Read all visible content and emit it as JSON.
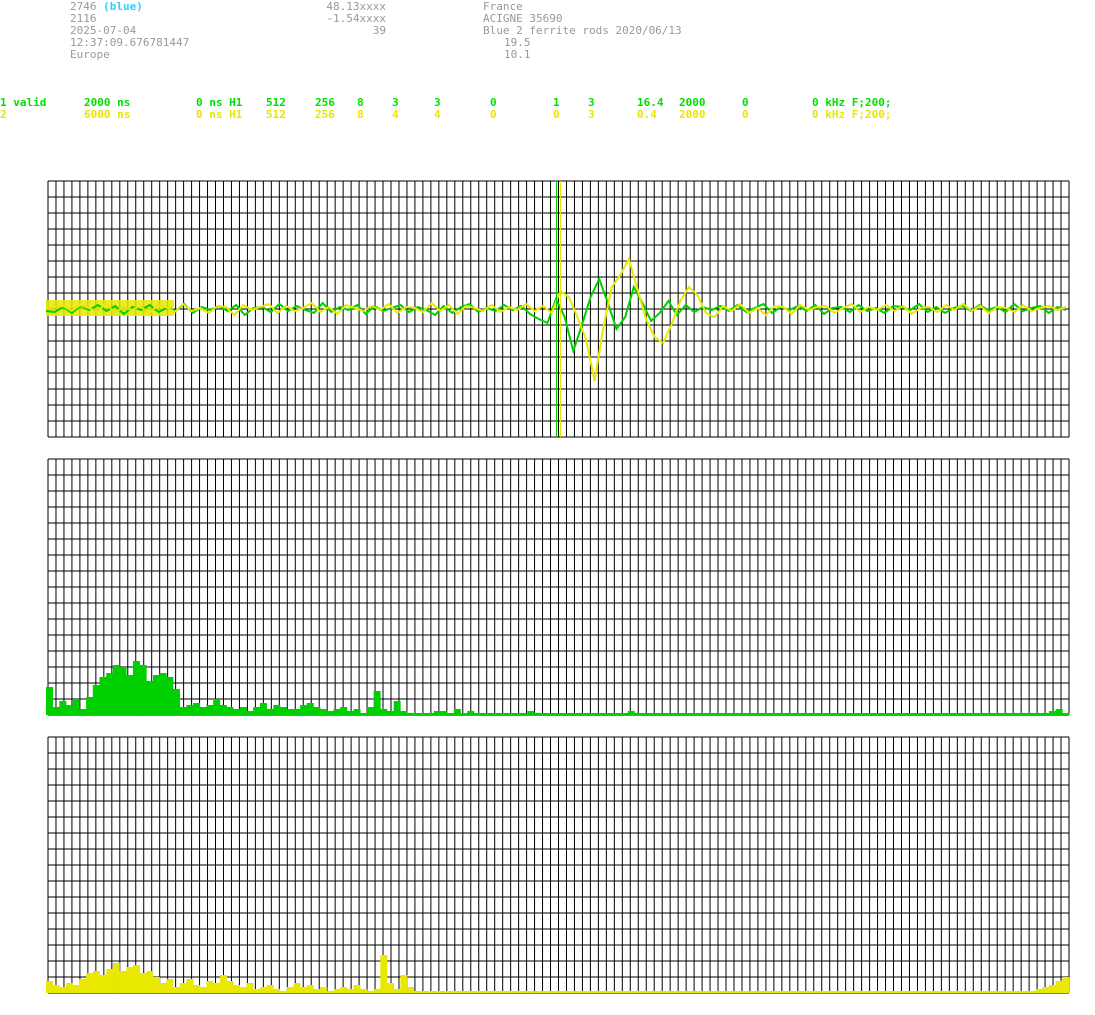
{
  "station": {
    "id": "2746",
    "color_label": "(blue)",
    "number": "2116",
    "date": "2025-07-04",
    "time": "12:37:09.676781447",
    "region": "Europe"
  },
  "coordinates": {
    "lat": "48.13xxxx",
    "lon": "-1.54xxxx",
    "value": "39"
  },
  "location": {
    "country": "France",
    "place": "ACIGNE 35690",
    "antenna": "Blue 2 ferrite rods 2020/06/13",
    "value_a": "19.5",
    "value_b": "10.1"
  },
  "channels": [
    {
      "id": "1 valid",
      "ns": "2000 ns",
      "offset": "0 ns H1",
      "c1": "512",
      "c2": "256",
      "c3": "8",
      "c4": "3",
      "c5": "3",
      "c6": "0",
      "c7": "1",
      "c8": "3",
      "c9": "16.4",
      "c10": "2000",
      "c11": "0",
      "khz": "0 kHz F;200;",
      "color": "#00e000"
    },
    {
      "id": "2",
      "ns": "6000 ns",
      "offset": "0 ns H1",
      "c1": "512",
      "c2": "256",
      "c3": "8",
      "c4": "4",
      "c5": "4",
      "c6": "0",
      "c7": "0",
      "c8": "3",
      "c9": "0.4",
      "c10": "2000",
      "c11": "0",
      "khz": "0 kHz F;200;",
      "color": "#e8e800"
    }
  ],
  "colors": {
    "grid": "#000000",
    "green": "#00d000",
    "yellow": "#e8e800",
    "muted_text": "#999999",
    "blue_label": "#33ccff"
  },
  "chart_data": [
    {
      "type": "line",
      "series": [
        {
          "values": [
            0,
            2,
            3,
            -2,
            4,
            1,
            -3,
            6,
            -4,
            2,
            -1,
            3,
            -5,
            4,
            2,
            -3,
            5,
            -2,
            1,
            -4,
            3,
            2,
            -6,
            4,
            -1,
            2,
            5,
            -4,
            3,
            -2,
            1,
            6,
            -3,
            2,
            -5,
            4,
            1,
            -2,
            3,
            -1,
            5,
            -4,
            2,
            1,
            -3,
            6,
            -2,
            4,
            -5,
            3,
            1,
            -2,
            4,
            -3,
            2,
            -1,
            5,
            -2,
            3,
            -4,
            18,
            12,
            -8,
            -30,
            -72,
            -20,
            22,
            34,
            50,
            20,
            -10,
            -28,
            -34,
            -15,
            8,
            22,
            14,
            -4,
            -8,
            3,
            -2,
            5,
            -4,
            1,
            -6,
            3,
            2,
            -5,
            4,
            -1,
            2,
            3,
            -4,
            1,
            5,
            -3,
            2,
            -1,
            4,
            -2,
            3,
            -5,
            1,
            2,
            -3,
            4,
            -1,
            5,
            -2,
            3,
            -4,
            2,
            1,
            -3,
            4,
            -2,
            1,
            3,
            -1,
            2
          ]
        },
        {
          "values": [
            -2,
            -3,
            2,
            -4,
            3,
            -1,
            4,
            -2,
            3,
            -5,
            2,
            -1,
            4,
            -3,
            1,
            -2,
            5,
            -4,
            2,
            -1,
            3,
            -2,
            4,
            -6,
            1,
            2,
            -3,
            5,
            -2,
            3,
            -1,
            -4,
            6,
            -3,
            2,
            -1,
            4,
            -5,
            3,
            -2,
            1,
            4,
            -3,
            2,
            -1,
            -6,
            3,
            -4,
            2,
            5,
            -3,
            1,
            -2,
            4,
            -1,
            3,
            -5,
            -10,
            -14,
            10,
            -8,
            -42,
            -16,
            12,
            30,
            6,
            -20,
            -8,
            22,
            6,
            -12,
            -4,
            8,
            -6,
            4,
            -3,
            2,
            -1,
            3,
            -2,
            4,
            -3,
            1,
            5,
            -4,
            2,
            -1,
            3,
            -2,
            4,
            -5,
            1,
            2,
            -3,
            4,
            -2,
            1,
            -4,
            3,
            2,
            -1,
            5,
            -3,
            2,
            -4,
            1,
            3,
            -2,
            4,
            -1,
            2,
            -3,
            5,
            -2,
            1,
            3,
            -4,
            2,
            -1
          ]
        }
      ],
      "cursor_fraction": 0.5
    },
    {
      "type": "bar",
      "values": [
        28,
        8,
        14,
        10,
        16,
        6,
        18,
        30,
        38,
        42,
        50,
        48,
        40,
        54,
        50,
        34,
        40,
        42,
        38,
        26,
        8,
        10,
        12,
        8,
        10,
        16,
        10,
        8,
        6,
        8,
        4,
        8,
        12,
        6,
        10,
        8,
        6,
        6,
        10,
        12,
        8,
        6,
        4,
        6,
        8,
        4,
        6,
        2,
        8,
        24,
        6,
        4,
        14,
        4,
        2,
        2,
        2,
        2,
        4,
        4,
        2,
        6,
        2,
        4,
        2,
        2,
        2,
        2,
        2,
        2,
        2,
        2,
        4,
        2,
        2,
        2,
        2,
        2,
        2,
        2,
        2,
        2,
        2,
        2,
        2,
        2,
        2,
        4,
        2,
        2,
        2,
        2,
        2,
        2,
        2,
        2,
        2,
        2,
        2,
        2,
        2,
        2,
        2,
        2,
        2,
        2,
        2,
        2,
        2,
        2,
        2,
        2,
        2,
        2,
        2,
        2,
        2,
        2,
        2,
        2,
        2,
        2,
        2,
        2,
        2,
        2,
        2,
        2,
        2,
        2,
        2,
        2,
        2,
        2,
        2,
        2,
        2,
        2,
        2,
        2,
        2,
        2,
        2,
        2,
        2,
        2,
        2,
        2,
        2,
        2,
        4,
        6,
        2
      ],
      "max": 60
    },
    {
      "type": "bar",
      "values": [
        12,
        8,
        6,
        10,
        8,
        14,
        20,
        22,
        18,
        24,
        30,
        22,
        26,
        28,
        20,
        22,
        16,
        10,
        14,
        6,
        10,
        14,
        8,
        6,
        12,
        10,
        18,
        12,
        8,
        6,
        10,
        4,
        6,
        8,
        4,
        2,
        6,
        10,
        6,
        8,
        4,
        6,
        2,
        4,
        6,
        4,
        8,
        4,
        2,
        4,
        38,
        10,
        4,
        18,
        6,
        2,
        2,
        2,
        2,
        2,
        2,
        2,
        2,
        2,
        2,
        2,
        2,
        2,
        2,
        2,
        2,
        2,
        2,
        2,
        2,
        2,
        2,
        2,
        2,
        2,
        2,
        2,
        2,
        2,
        2,
        2,
        2,
        2,
        2,
        2,
        2,
        2,
        2,
        2,
        2,
        2,
        2,
        2,
        2,
        2,
        2,
        2,
        2,
        2,
        2,
        2,
        2,
        2,
        2,
        2,
        2,
        2,
        2,
        2,
        2,
        2,
        2,
        2,
        2,
        2,
        2,
        2,
        2,
        2,
        2,
        2,
        2,
        2,
        2,
        2,
        2,
        2,
        2,
        2,
        2,
        2,
        2,
        2,
        2,
        2,
        2,
        2,
        2,
        2,
        2,
        2,
        2,
        2,
        4,
        6,
        8,
        12,
        16
      ],
      "max": 60
    }
  ]
}
